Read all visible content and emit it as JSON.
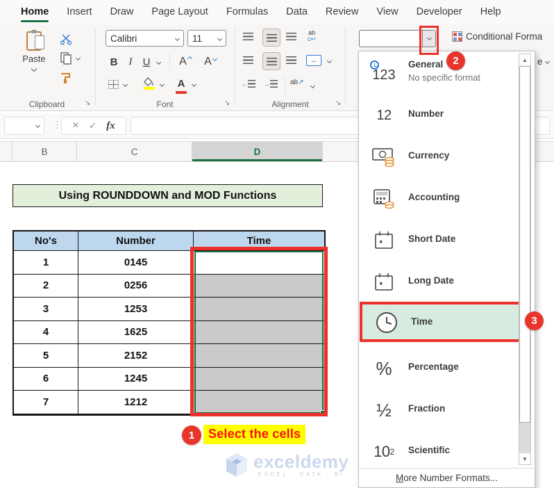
{
  "menu_bar": {
    "items": [
      "Home",
      "Insert",
      "Draw",
      "Page Layout",
      "Formulas",
      "Data",
      "Review",
      "View",
      "Developer",
      "Help"
    ],
    "active_item": "Home"
  },
  "ribbon": {
    "groups": {
      "clipboard": "Clipboard",
      "font": "Font",
      "alignment": "Alignment"
    },
    "paste_label": "Paste",
    "font_name": "Calibri",
    "font_size": "11",
    "bold": "B",
    "italic": "I",
    "underline": "U",
    "grow_font_letter": "A",
    "shrink_font_letter": "A",
    "font_color_letter": "A",
    "wrap_text_glyph": "ab",
    "orientation_glyph": "ab",
    "merge_glyph": "↔",
    "number_format_value": "",
    "conditional_formatting_label": "Conditional Forma",
    "clipped_button_fragment": "e"
  },
  "formula_bar": {
    "name_box_value": "",
    "cancel_icon": "×",
    "enter_icon": "✓",
    "fx_icon": "fx",
    "formula_value": ""
  },
  "column_headers": {
    "letters": [
      "B",
      "C",
      "D"
    ],
    "selected": "D"
  },
  "worksheet": {
    "title": "Using ROUNDDOWN and MOD Functions",
    "table": {
      "headers": [
        "No's",
        "Number",
        "Time"
      ],
      "rows": [
        {
          "no": "1",
          "number": "0145",
          "time": ""
        },
        {
          "no": "2",
          "number": "0256",
          "time": ""
        },
        {
          "no": "3",
          "number": "1253",
          "time": ""
        },
        {
          "no": "4",
          "number": "1625",
          "time": ""
        },
        {
          "no": "5",
          "number": "2152",
          "time": ""
        },
        {
          "no": "6",
          "number": "1245",
          "time": ""
        },
        {
          "no": "7",
          "number": "1212",
          "time": ""
        }
      ]
    }
  },
  "format_dropdown": {
    "items": [
      {
        "label": "General",
        "sublabel": "No specific format",
        "icon": "general-123-icon",
        "glyph": "123"
      },
      {
        "label": "Number",
        "icon": "number-12-icon",
        "glyph": "12"
      },
      {
        "label": "Currency",
        "icon": "currency-icon"
      },
      {
        "label": "Accounting",
        "icon": "accounting-icon"
      },
      {
        "label": "Short Date",
        "icon": "calendar-icon"
      },
      {
        "label": "Long Date",
        "icon": "calendar-icon"
      },
      {
        "label": "Time",
        "icon": "clock-icon",
        "selected": true
      },
      {
        "label": "Percentage",
        "icon": "percent-icon",
        "glyph": "%"
      },
      {
        "label": "Fraction",
        "icon": "fraction-icon",
        "glyph": "½"
      },
      {
        "label": "Scientific",
        "icon": "scientific-icon",
        "glyph": "10",
        "glyph_sup": "2"
      }
    ],
    "scroll_up_glyph": "▲",
    "scroll_down_glyph": "▼",
    "more_label": "More Number Formats..."
  },
  "annotations": {
    "step1_badge": "1",
    "step1_label": "Select the cells",
    "step2_badge": "2",
    "step3_badge": "3"
  },
  "watermark": {
    "brand": "exceldemy",
    "tagline": "EXCEL · DATA · BI"
  },
  "colors": {
    "excel_green": "#1e7145",
    "annotation_red": "#ee302b",
    "highlight_yellow": "#ffff00",
    "annotation_text_red": "#ff0f0f",
    "table_header_blue": "#bdd7ee",
    "title_fill_green": "#e2efda",
    "selected_cells_gray": "#cacaca",
    "time_item_green": "#d8ebe0",
    "watermark_blue": "#ccd8ee"
  }
}
